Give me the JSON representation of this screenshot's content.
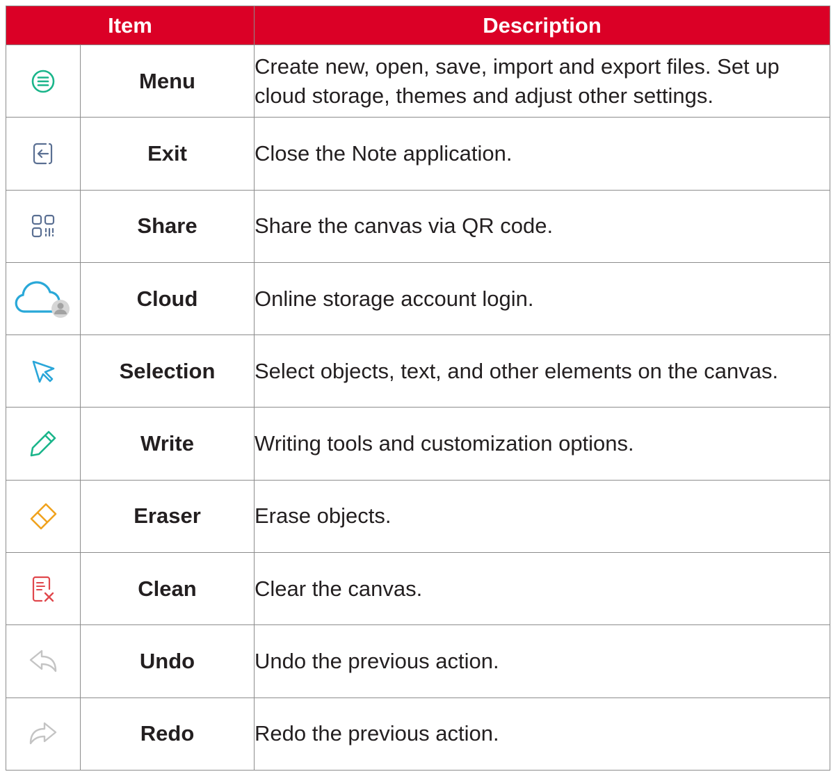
{
  "header": {
    "item": "Item",
    "description": "Description"
  },
  "rows": [
    {
      "icon": "menu-icon",
      "name": "Menu",
      "description": "Create new, open, save, import and export files. Set up cloud storage, themes and adjust other settings."
    },
    {
      "icon": "exit-icon",
      "name": "Exit",
      "description": "Close the Note application."
    },
    {
      "icon": "qr-code-icon",
      "name": "Share",
      "description": "Share the canvas via QR code."
    },
    {
      "icon": "cloud-user-icon",
      "name": "Cloud",
      "description": "Online storage account login."
    },
    {
      "icon": "cursor-arrow-icon",
      "name": "Selection",
      "description": "Select objects, text, and other elements on the canvas."
    },
    {
      "icon": "pen-icon",
      "name": "Write",
      "description": "Writing tools and customization options."
    },
    {
      "icon": "eraser-icon",
      "name": "Eraser",
      "description": "Erase objects."
    },
    {
      "icon": "clean-document-icon",
      "name": "Clean",
      "description": "Clear the canvas."
    },
    {
      "icon": "undo-arrow-icon",
      "name": "Undo",
      "description": "Undo the previous action."
    },
    {
      "icon": "redo-arrow-icon",
      "name": "Redo",
      "description": "Redo the previous action."
    }
  ],
  "colors": {
    "header_background": "#db0026",
    "header_text": "#ffffff",
    "menu_icon": "#1ab58a",
    "share_icon": "#5a6f92",
    "cloud_icon": "#29a8d8",
    "selection_icon": "#2aa6d9",
    "write_icon": "#1ab58a",
    "eraser_icon": "#f0a21e",
    "clean_icon": "#e0474c",
    "undo_redo_icon": "#c4c4c4"
  }
}
